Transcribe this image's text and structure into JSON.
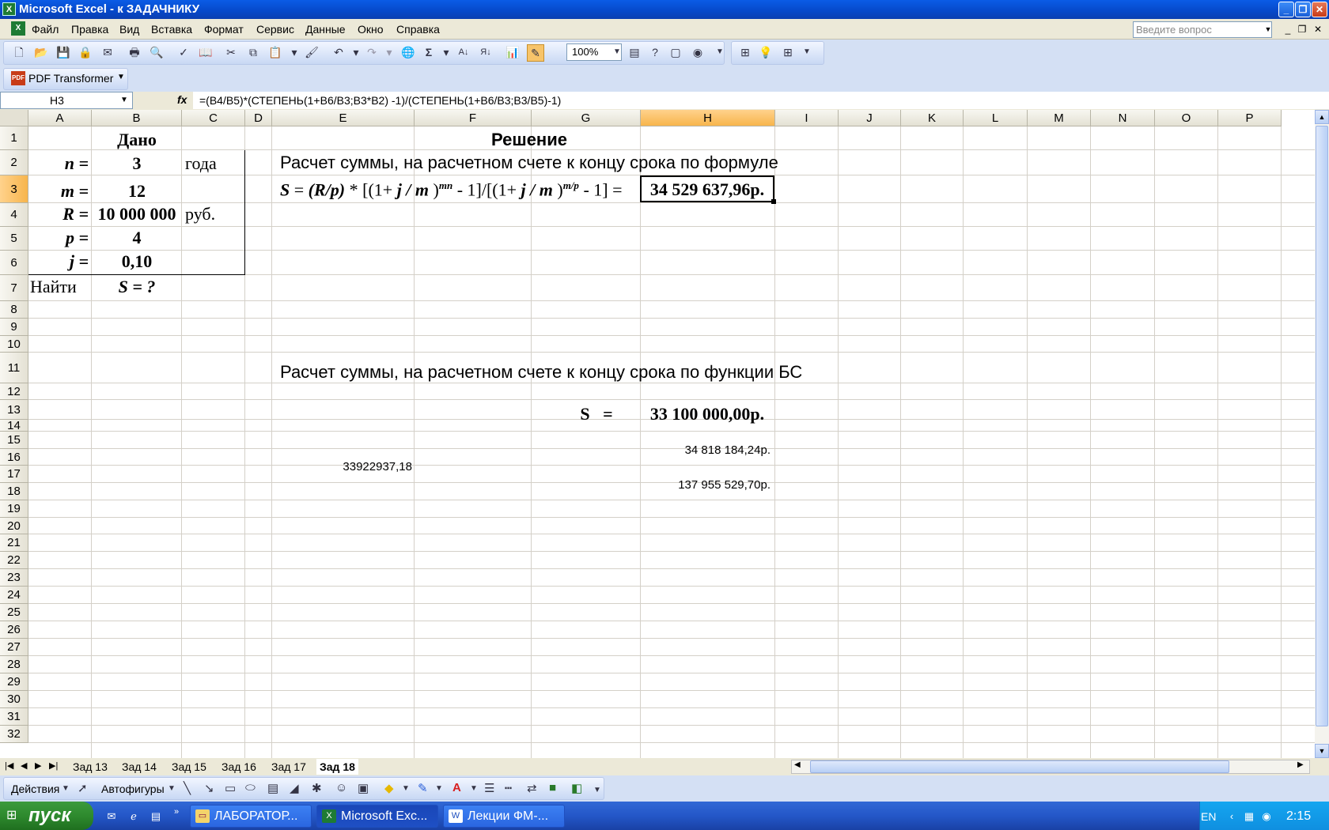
{
  "window": {
    "title": "Microsoft Excel - к ЗАДАЧНИКУ",
    "app_icon": "excel-icon",
    "controls": [
      "minimize-icon",
      "restore-icon",
      "close-icon"
    ]
  },
  "menu": {
    "items": [
      "Файл",
      "Правка",
      "Вид",
      "Вставка",
      "Формат",
      "Сервис",
      "Данные",
      "Окно",
      "Справка"
    ],
    "help_placeholder": "Введите вопрос"
  },
  "toolbar": {
    "zoom": "100%",
    "pdf_transformer": "PDF Transformer"
  },
  "formula_bar": {
    "name_box": "H3",
    "fx": "fx",
    "formula": "=(B4/B5)*(СТЕПЕНЬ(1+B6/B3;B3*B2) -1)/(СТЕПЕНЬ(1+B6/B3;B3/B5)-1)"
  },
  "sheet": {
    "columns": [
      "A",
      "B",
      "C",
      "D",
      "E",
      "F",
      "G",
      "H",
      "I",
      "J",
      "K",
      "L",
      "M",
      "N",
      "O",
      "P"
    ],
    "selected_column": "H",
    "selected_row": "3",
    "rows": [
      "1",
      "2",
      "3",
      "4",
      "5",
      "6",
      "7",
      "8",
      "9",
      "10",
      "11",
      "12",
      "13",
      "14",
      "15",
      "16",
      "17",
      "18",
      "19",
      "20",
      "21",
      "22",
      "23",
      "24",
      "25",
      "26",
      "27",
      "28",
      "29",
      "30",
      "31",
      "32"
    ],
    "cells": {
      "B1": "Дано",
      "F1": "Решение",
      "A2": "n =",
      "B2": "3",
      "C2": "года",
      "E2": "Расчет суммы, на расчетном счете к концу срока по формуле",
      "A3": "m =",
      "B3": "12",
      "E3_parts": {
        "s": "S",
        "eq1": " = ",
        "rp": "(R/p)",
        "mul": " * [(1+ ",
        "jm1": "j / m",
        "close1": " )",
        "exp1": "mn",
        "minus1": " - 1]/[(1+ ",
        "jm2": "j / m",
        "close2": " )",
        "exp2": "m/p",
        "minus2": " - 1] ="
      },
      "H3": "34 529 637,96р.",
      "A4": "R =",
      "B4": "10 000 000",
      "C4": "руб.",
      "A5": "p =",
      "B5": "4",
      "A6": "j =",
      "B6": "0,10",
      "A7": "Найти",
      "B7": "S = ?",
      "E11": "Расчет суммы, на расчетном счете к концу срока по функции БС",
      "G13": "S   =",
      "H13": "33 100 000,00р.",
      "H15": "34 818 184,24р.",
      "E16": "33922937,18",
      "H17": "137 955 529,70р."
    }
  },
  "sheet_tabs": {
    "tabs": [
      "Зад 13",
      "Зад 14",
      "Зад 15",
      "Зад 16",
      "Зад 17",
      "Зад 18"
    ],
    "active": "Зад 18"
  },
  "drawing_toolbar": {
    "actions": "Действия",
    "autoshapes": "Автофигуры"
  },
  "taskbar": {
    "start": "пуск",
    "apps": [
      "ЛАБОРАТОР...",
      "Microsoft Exc...",
      "Лекции ФМ-..."
    ],
    "active_app": "Microsoft Exc...",
    "language": "EN",
    "clock": "2:15"
  }
}
